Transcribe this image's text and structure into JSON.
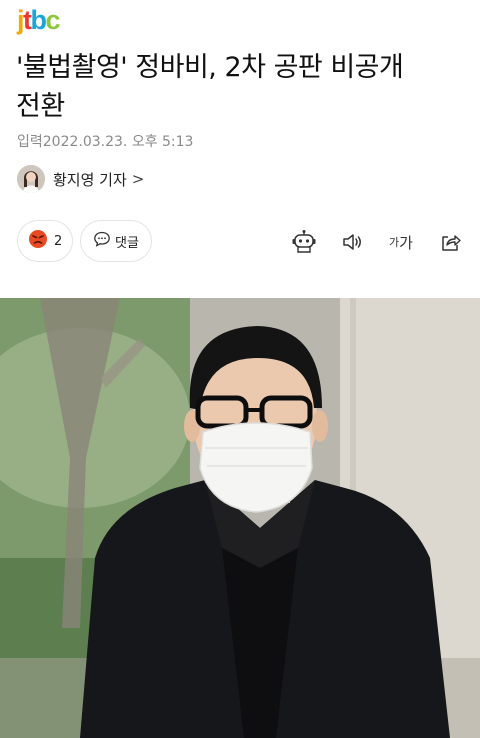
{
  "header": {
    "logo_text": "jtbc"
  },
  "article": {
    "title_line1": "'불법촬영' 정바비, 2차 공판 비공개",
    "title_line2": "전환",
    "timestamp": "입력2022.03.23. 오후 5:13",
    "reporter": "황지영 기자",
    "reporter_chevron": ">"
  },
  "actions": {
    "reaction_count": "2",
    "comment_label": "댓글",
    "font_size_label_small": "가",
    "font_size_label_big": "가"
  },
  "colors": {
    "logo_j": "#f2a900",
    "logo_t": "#e8382f",
    "logo_b": "#1aa6d9",
    "logo_c": "#8cc63f",
    "reaction": "#e84b24"
  },
  "icons": [
    "robot-icon",
    "speaker-icon",
    "font-size-icon",
    "share-icon",
    "comment-icon",
    "angry-reaction-icon"
  ]
}
